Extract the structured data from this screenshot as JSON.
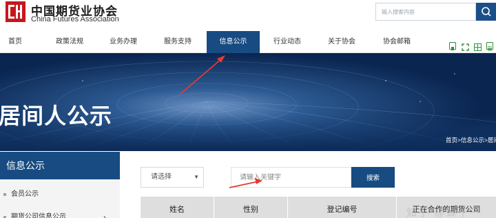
{
  "header": {
    "logo_cn": "中国期货业协会",
    "logo_en": "China Futures Association",
    "search_placeholder": "输入搜索内容"
  },
  "nav": {
    "items": [
      {
        "label": "首页"
      },
      {
        "label": "政策法规"
      },
      {
        "label": "业务办理"
      },
      {
        "label": "服务支持"
      },
      {
        "label": "信息公示",
        "active": true
      },
      {
        "label": "行业动态"
      },
      {
        "label": "关于协会"
      },
      {
        "label": "协会邮箱"
      }
    ],
    "tool_icons": [
      "green-square-icon",
      "expand-icon",
      "grid-icon",
      "list-icon"
    ]
  },
  "banner": {
    "title": "居间人公示",
    "breadcrumb": "首页>信息公示>居间"
  },
  "sidebar": {
    "heading": "信息公示",
    "items": [
      {
        "label": "会员公示"
      },
      {
        "label": "期货公司信息公示"
      }
    ]
  },
  "filters": {
    "select_value": "请选择",
    "keyword_placeholder": "请输入关键字",
    "search_label": "搜索"
  },
  "table": {
    "columns": [
      "姓名",
      "性别",
      "登记编号",
      "正在合作的期货公司"
    ]
  },
  "watermark": "知乎 @蝉十一",
  "colors": {
    "brand_blue": "#174b82",
    "logo_red": "#c8161d",
    "annotation_red": "#e53935"
  }
}
